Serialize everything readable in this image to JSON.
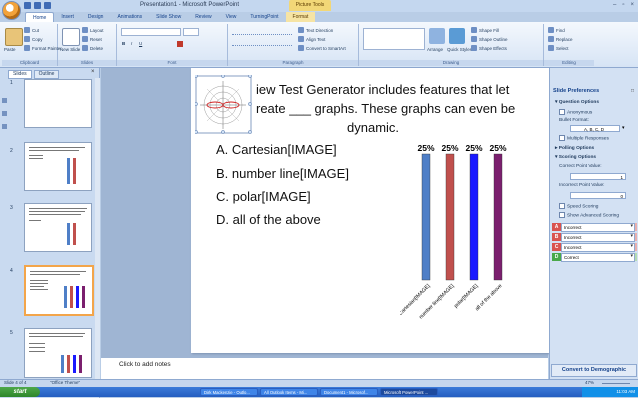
{
  "window": {
    "title": "Presentation1 - Microsoft PowerPoint",
    "contextual_tab": "Picture Tools"
  },
  "ribbon": {
    "tabs": [
      "Home",
      "Insert",
      "Design",
      "Animations",
      "Slide Show",
      "Review",
      "View",
      "TurningPoint",
      "Format"
    ],
    "clipboard": {
      "paste": "Paste",
      "cut": "Cut",
      "copy": "Copy",
      "format_painter": "Format Painter",
      "label": "Clipboard"
    },
    "slides": {
      "new_slide": "New Slide",
      "layout": "Layout",
      "reset": "Reset",
      "delete": "Delete",
      "label": "Slides"
    },
    "font": {
      "label": "Font",
      "bold": "B",
      "italic": "I",
      "underline": "U"
    },
    "paragraph": {
      "text_direction": "Text Direction",
      "align_text": "Align Text",
      "convert_smartart": "Convert to SmartArt",
      "label": "Paragraph"
    },
    "drawing": {
      "arrange": "Arrange",
      "quick_styles": "Quick Styles",
      "shape_fill": "Shape Fill",
      "shape_outline": "Shape Outline",
      "shape_effects": "Shape Effects",
      "label": "Drawing"
    },
    "editing": {
      "find": "Find",
      "replace": "Replace",
      "select": "Select",
      "label": "Editing"
    }
  },
  "left_panel": {
    "tabs": [
      "Slides",
      "Outline"
    ],
    "slide_numbers": [
      "1",
      "2",
      "3",
      "4",
      "5"
    ]
  },
  "slide": {
    "question_line1": "iew Test Generator includes features that let",
    "question_line2": "reate ___ graphs. These graphs can even be",
    "question_line3": "dynamic.",
    "options": [
      "A.  Cartesian[IMAGE]",
      "B.  number line[IMAGE]",
      "C.  polar[IMAGE]",
      "D.  all of the above"
    ]
  },
  "chart_data": {
    "type": "bar",
    "categories": [
      "Cartesian[IMAGE]",
      "number line[IMAGE]",
      "polar[IMAGE]",
      "all of the above"
    ],
    "values": [
      25,
      25,
      25,
      25
    ],
    "labels": [
      "25%",
      "25%",
      "25%",
      "25%"
    ],
    "colors": [
      "#4f7fc7",
      "#c0504d",
      "#1a1aff",
      "#7b1f6e"
    ],
    "ylim": [
      0,
      100
    ]
  },
  "notes": {
    "placeholder": "Click to add notes"
  },
  "right_pane": {
    "title": "Slide Preferences",
    "question_options": "Question Options",
    "anonymous": "Anonymous",
    "bullet_format": "Bullet Format:",
    "bullet_value": "A, B, C, D",
    "multiple_responses": "Multiple Responses",
    "polling_options": "Polling Options",
    "scoring_options": "Scoring Options",
    "correct_point": "Correct Point Value:",
    "correct_value": "1",
    "incorrect_point": "Incorrect Point Value:",
    "incorrect_value": "0",
    "speed_scoring": "Speed Scoring",
    "show_advanced": "Show Advanced Scoring",
    "answers": [
      {
        "letter": "A",
        "value": "Incorrect",
        "color": "#d9534f"
      },
      {
        "letter": "B",
        "value": "Incorrect",
        "color": "#d9534f"
      },
      {
        "letter": "C",
        "value": "Incorrect",
        "color": "#d9534f"
      },
      {
        "letter": "D",
        "value": "Correct",
        "color": "#4aa84a"
      }
    ],
    "convert_button": "Convert to Demographic"
  },
  "status": {
    "slide_info": "Slide 4 of 4",
    "theme": "\"Office Theme\"",
    "zoom": "47%"
  },
  "taskbar": {
    "start": "start",
    "items": [
      "Dirk Mackenzie - Outlo...",
      "All Outlook Items - Mi...",
      "Document1 - Microsof...",
      "Microsoft PowerPoint ..."
    ],
    "clock": "11:03 AM"
  }
}
